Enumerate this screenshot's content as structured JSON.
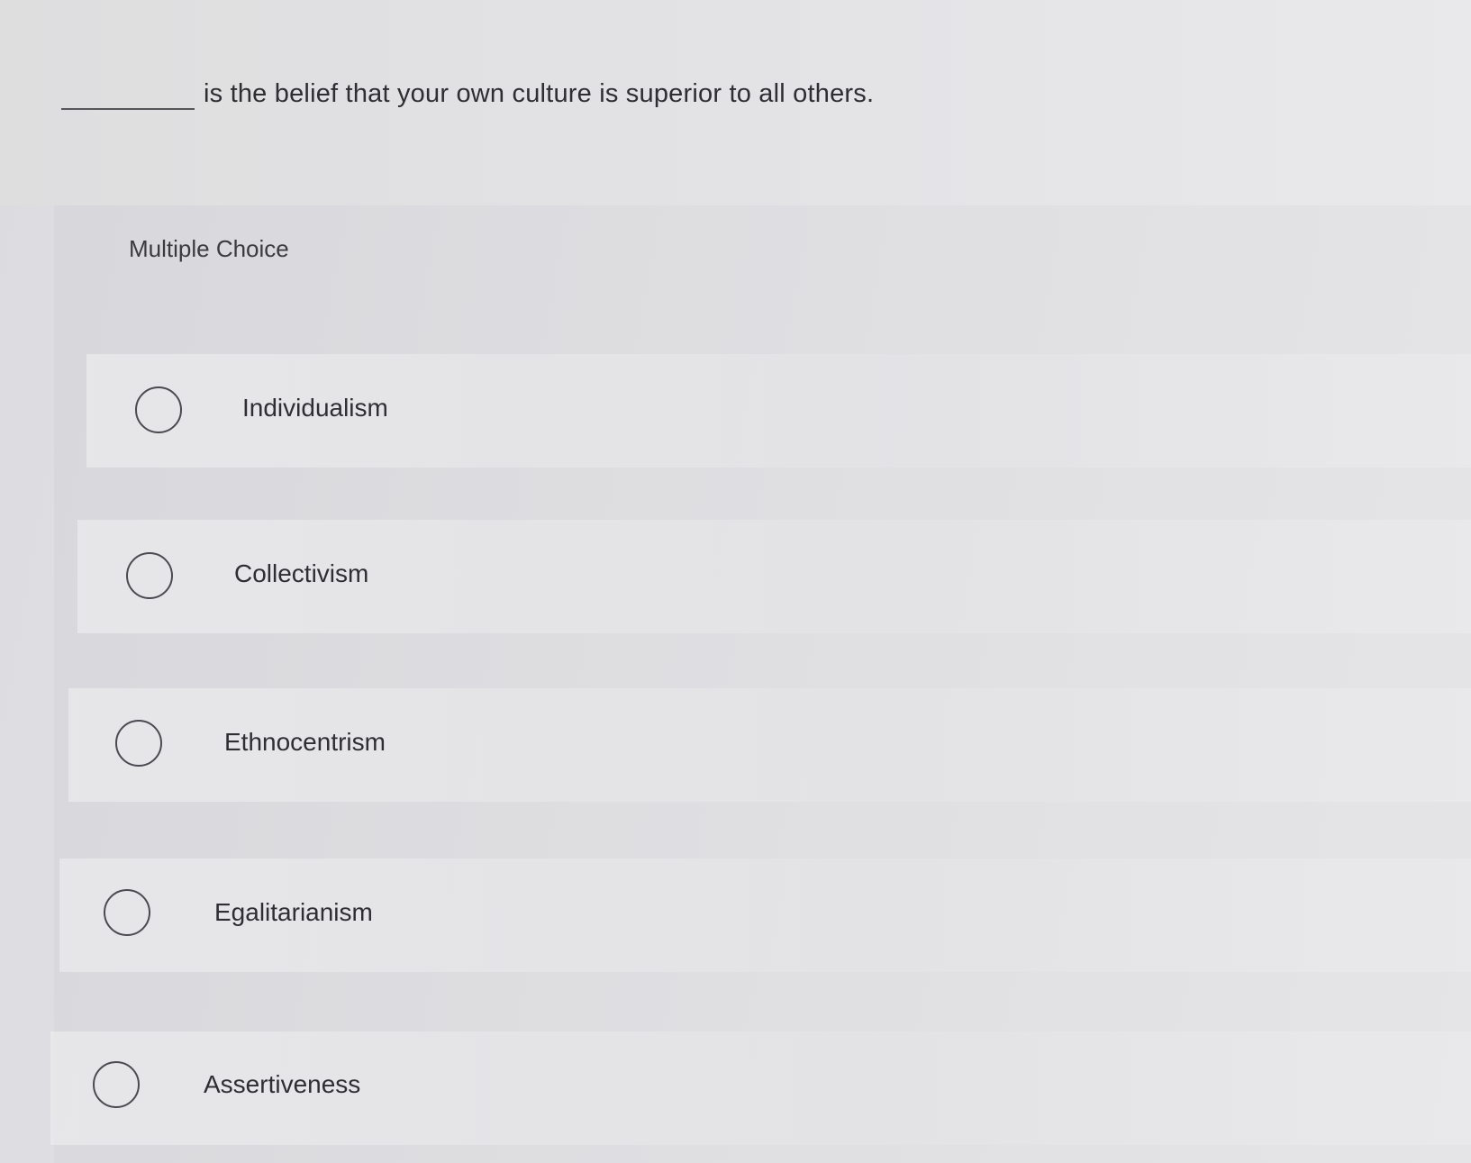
{
  "question": {
    "text": "is the belief that your own culture is superior to all others."
  },
  "section_label": "Multiple Choice",
  "options": [
    {
      "label": "Individualism",
      "selected": false
    },
    {
      "label": "Collectivism",
      "selected": false
    },
    {
      "label": "Ethnocentrism",
      "selected": false
    },
    {
      "label": "Egalitarianism",
      "selected": false
    },
    {
      "label": "Assertiveness",
      "selected": false
    }
  ],
  "icons": {
    "radio": "radio-button-unselected-icon"
  }
}
